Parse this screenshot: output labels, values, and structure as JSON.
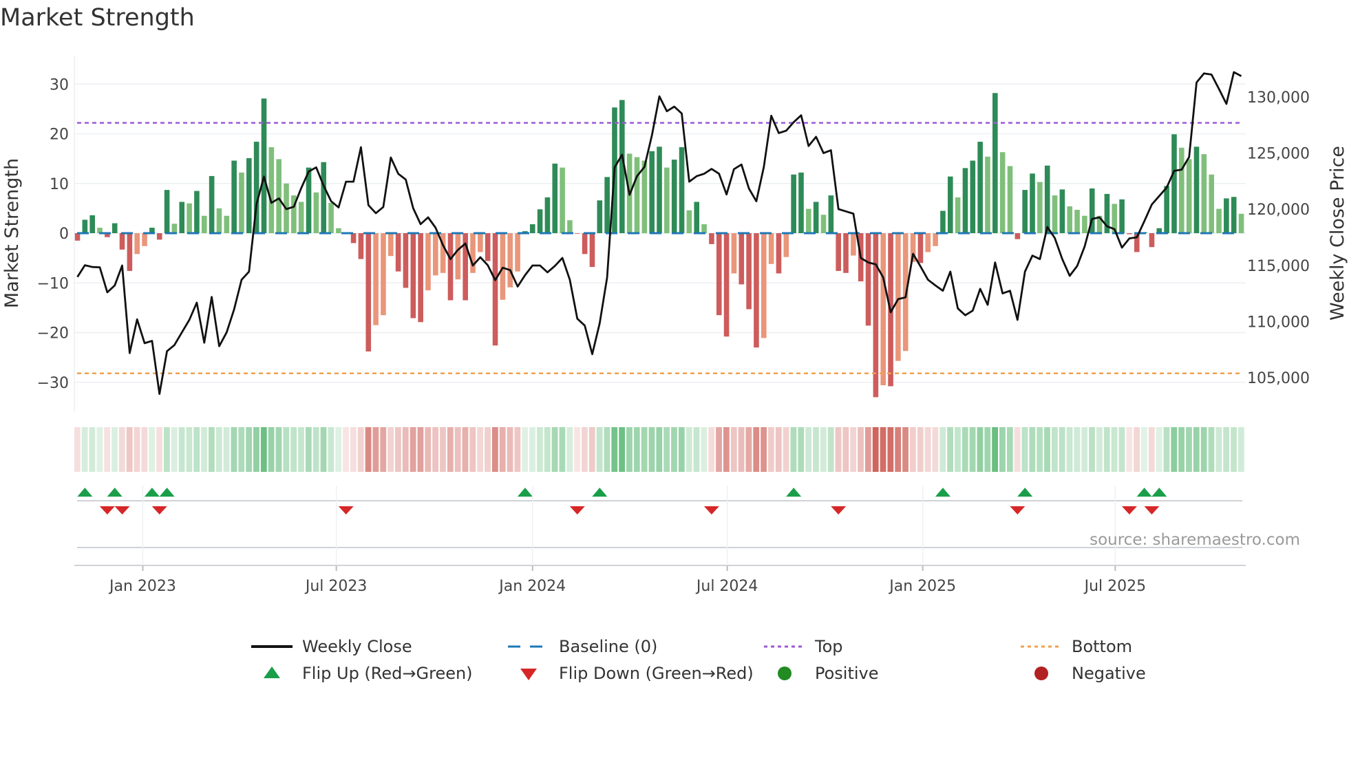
{
  "title": "Market Strength",
  "source": "source: sharemaestro.com",
  "colors": {
    "pos_strong": "#2e8b57",
    "pos_weak": "#7fbf7b",
    "neg_strong": "#cd5c5c",
    "neg_weak": "#e9967a",
    "price_line": "#111111",
    "baseline": "#1f77b4",
    "top": "#9b59d9",
    "bottom": "#f0a050",
    "flip_up": "#1a9e4a",
    "flip_down": "#d62728",
    "positive": "#228b22",
    "negative": "#b22222"
  },
  "legend": [
    {
      "label": "Weekly Close",
      "symbol": "line"
    },
    {
      "label": "Baseline (0)",
      "symbol": "dash"
    },
    {
      "label": "Top",
      "symbol": "dot-purple"
    },
    {
      "label": "Bottom",
      "symbol": "dot-orange"
    },
    {
      "label": "Flip Up (Red→Green)",
      "symbol": "tri-up"
    },
    {
      "label": "Flip Down (Green→Red)",
      "symbol": "tri-down"
    },
    {
      "label": "Positive",
      "symbol": "circle-green"
    },
    {
      "label": "Negative",
      "symbol": "circle-red"
    }
  ],
  "chart_data": {
    "type": "bar",
    "title": "Market Strength",
    "xlabel": "",
    "ylabel": "Market Strength",
    "y2label": "Weekly Close Price",
    "ylim": [
      -36,
      35
    ],
    "y2lim": [
      102300,
      132200
    ],
    "yticks": [
      "30",
      "20",
      "10",
      "0",
      "−10",
      "−20",
      "−30"
    ],
    "ytick_values": [
      30,
      20,
      10,
      0,
      -10,
      -20,
      -30
    ],
    "y2ticks": [
      "130,000",
      "125,000",
      "120,000",
      "115,000",
      "110,000",
      "105,000"
    ],
    "y2tick_values": [
      130000,
      125000,
      120000,
      115000,
      110000,
      105000
    ],
    "x_ticks": [
      {
        "label": "Jan 2023",
        "week": 8.76
      },
      {
        "label": "Jul 2023",
        "week": 34.7
      },
      {
        "label": "Jan 2024",
        "week": 61.0
      },
      {
        "label": "Jul 2024",
        "week": 87.1
      },
      {
        "label": "Jan 2025",
        "week": 113.3
      },
      {
        "label": "Jul 2025",
        "week": 139.1
      }
    ],
    "top_level": 22.2,
    "bottom_level": -28.2,
    "baseline": 0,
    "grid": true,
    "legend_placement": "bottom",
    "strength": [
      -1.5,
      2.7,
      3.6,
      1.1,
      -0.8,
      2.0,
      -3.3,
      -7.6,
      -4.2,
      -2.6,
      1.1,
      -1.3,
      8.7,
      1.9,
      6.3,
      6.0,
      8.5,
      3.5,
      11.5,
      5.0,
      3.5,
      14.6,
      12.2,
      15.1,
      18.4,
      27.1,
      17.3,
      14.9,
      10.0,
      7.6,
      6.3,
      13.2,
      8.2,
      14.3,
      6.1,
      1.0,
      -0.2,
      -2.0,
      -5.2,
      -23.8,
      -18.5,
      -16.5,
      -4.6,
      -7.7,
      -11.0,
      -17.1,
      -17.9,
      -11.5,
      -8.5,
      -8.0,
      -13.5,
      -9.3,
      -13.5,
      -8.0,
      -3.8,
      -5.6,
      -22.6,
      -13.4,
      -10.9,
      -7.7,
      0.4,
      1.8,
      4.8,
      7.2,
      14.0,
      13.2,
      2.6,
      -0.1,
      -4.2,
      -6.8,
      6.6,
      11.3,
      25.3,
      26.8,
      16.0,
      15.3,
      14.6,
      16.5,
      17.4,
      13.2,
      14.8,
      17.3,
      4.6,
      6.3,
      1.8,
      -2.2,
      -16.5,
      -20.8,
      -8.1,
      -10.3,
      -15.3,
      -23.0,
      -21.1,
      -6.2,
      -8.1,
      -4.8,
      11.8,
      12.2,
      4.9,
      6.3,
      3.7,
      7.6,
      -7.6,
      -8.0,
      -4.5,
      -9.7,
      -18.6,
      -33.0,
      -30.6,
      -30.8,
      -25.7,
      -23.7,
      -5.8,
      -6.0,
      -3.8,
      -2.6,
      4.5,
      11.4,
      7.2,
      13.1,
      14.6,
      18.4,
      15.4,
      28.2,
      16.3,
      13.5,
      -1.2,
      8.7,
      12.0,
      10.3,
      13.6,
      7.6,
      8.8,
      5.4,
      4.7,
      3.5,
      9.0,
      3.5,
      7.9,
      5.9,
      6.8,
      -0.2,
      -3.8,
      0.2,
      -2.8,
      1.0,
      9.5,
      19.9,
      17.2,
      14.9,
      17.4,
      15.9,
      11.8,
      4.9,
      7.0,
      7.3,
      3.9
    ],
    "weekly_close": [
      113970,
      115010,
      114850,
      114830,
      112600,
      113210,
      114990,
      107190,
      110190,
      108070,
      108270,
      103550,
      107350,
      107900,
      109030,
      110150,
      111680,
      108110,
      112190,
      107800,
      109030,
      111070,
      113720,
      114440,
      120460,
      122910,
      120570,
      120970,
      120010,
      120220,
      121890,
      123360,
      123730,
      122100,
      120710,
      120160,
      122460,
      122460,
      125530,
      120360,
      119650,
      120200,
      124610,
      123160,
      122650,
      120100,
      118670,
      119280,
      118360,
      116790,
      115560,
      116380,
      116950,
      114990,
      115720,
      115010,
      113680,
      114790,
      114580,
      113110,
      114130,
      114990,
      114990,
      114380,
      114950,
      115660,
      113720,
      110250,
      109640,
      107090,
      109840,
      113930,
      123730,
      124850,
      121280,
      122950,
      123770,
      126590,
      130060,
      128730,
      129140,
      128530,
      122460,
      122950,
      123160,
      123590,
      123160,
      121320,
      123570,
      123980,
      121850,
      120710,
      123770,
      128330,
      126790,
      127000,
      127750,
      128370,
      125630,
      126450,
      125000,
      125260,
      120010,
      119810,
      119610,
      115660,
      115260,
      115090,
      113930,
      110820,
      111990,
      112150,
      116030,
      114910,
      113720,
      113210,
      112740,
      114440,
      111170,
      110560,
      110970,
      112910,
      111480,
      115260,
      112500,
      112740,
      110150,
      114440,
      115870,
      115560,
      118420,
      117440,
      115560,
      114070,
      114950,
      116680,
      119140,
      119280,
      118480,
      118220,
      116580,
      117400,
      117500,
      118930,
      120420,
      121180,
      121930,
      123420,
      123530,
      124650,
      131290,
      132100,
      132000,
      130720,
      129390,
      132210,
      131860
    ]
  }
}
